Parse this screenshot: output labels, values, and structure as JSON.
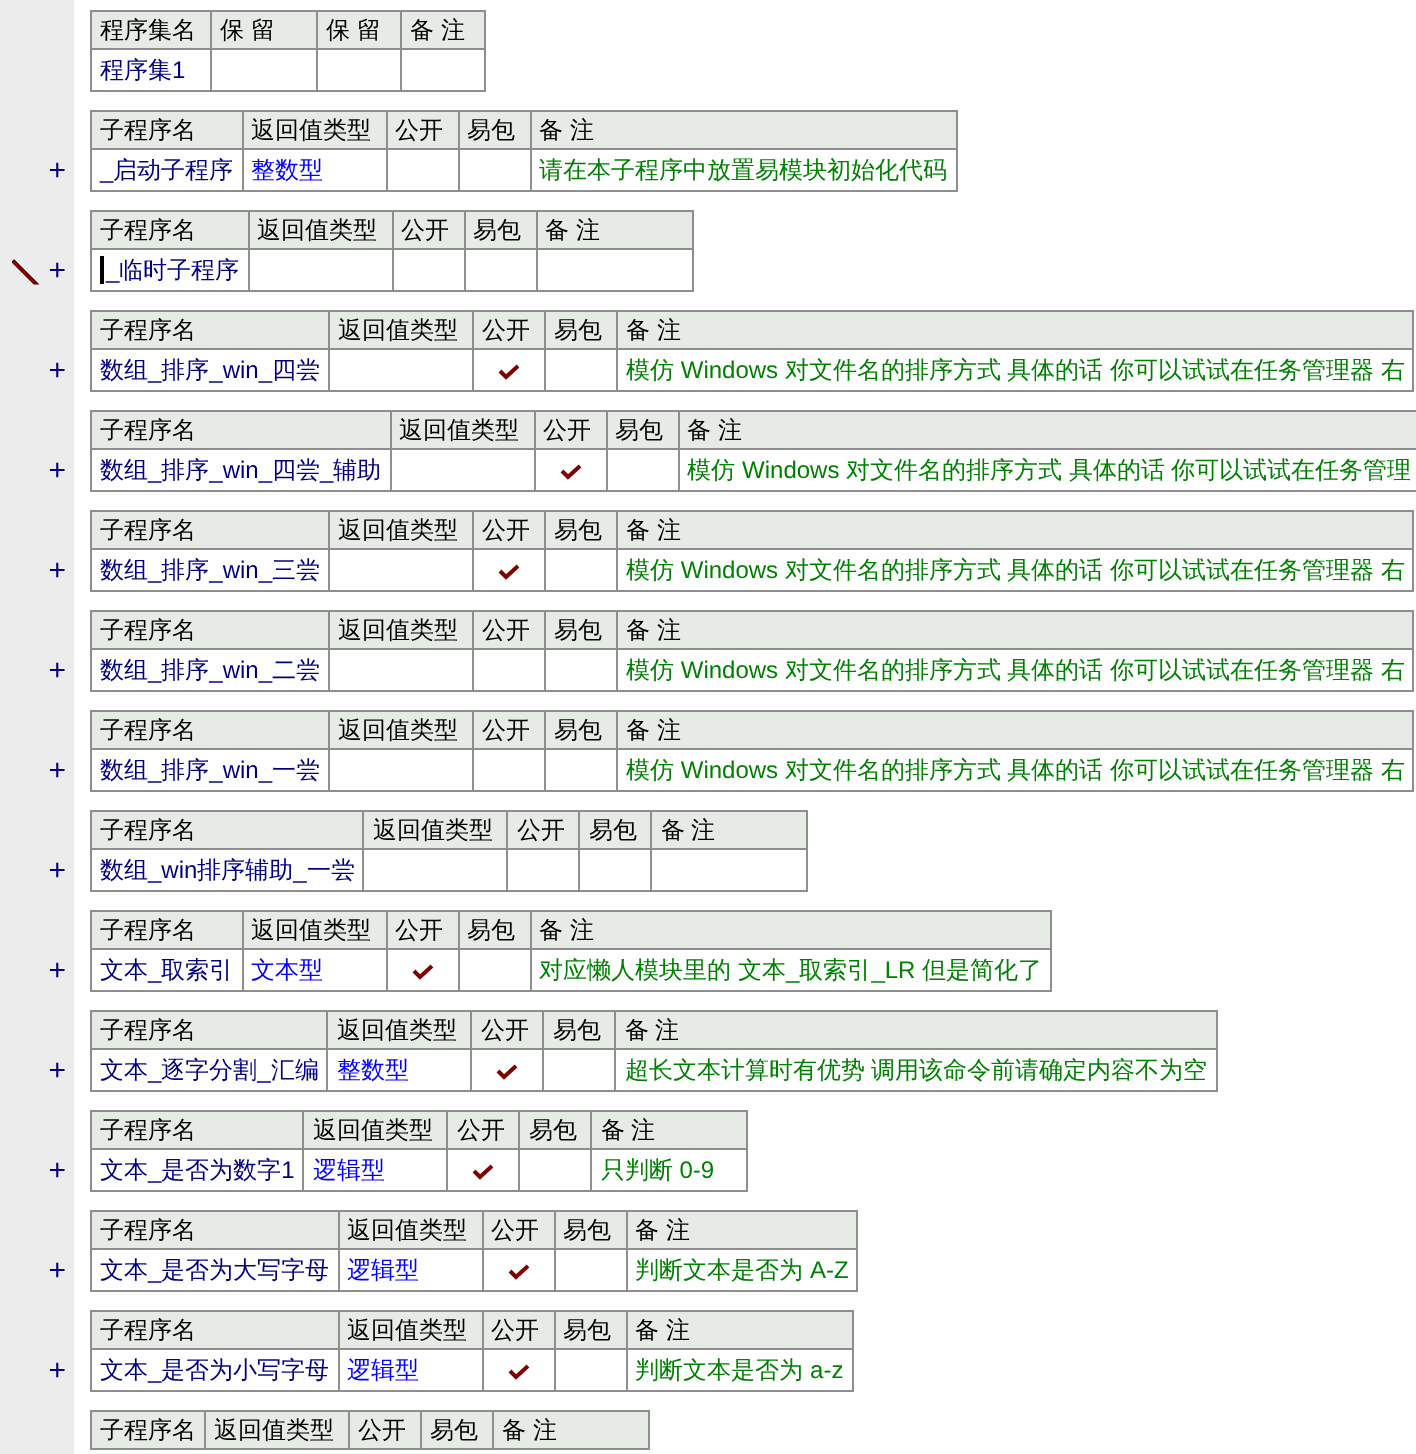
{
  "assembly": {
    "columns": [
      "程序集名",
      "保 留",
      "保 留",
      "备 注"
    ],
    "name": "程序集1"
  },
  "subprograms": [
    {
      "expander": "+",
      "editing": false,
      "columns": [
        "子程序名",
        "返回值类型",
        "公开",
        "易包",
        "备 注"
      ],
      "name": "_启动子程序",
      "return_type": "整数型",
      "public": false,
      "remark": "请在本子程序中放置易模块初始化代码"
    },
    {
      "expander": "+",
      "editing": true,
      "columns": [
        "子程序名",
        "返回值类型",
        "公开",
        "易包",
        "备 注"
      ],
      "name": "_临时子程序",
      "public": false
    },
    {
      "expander": "+",
      "editing": false,
      "columns": [
        "子程序名",
        "返回值类型",
        "公开",
        "易包",
        "备 注"
      ],
      "name": "数组_排序_win_四尝",
      "public": true,
      "remark": "模仿 Windows 对文件名的排序方式 具体的话 你可以试试在任务管理器 右"
    },
    {
      "expander": "+",
      "editing": false,
      "columns": [
        "子程序名",
        "返回值类型",
        "公开",
        "易包",
        "备 注"
      ],
      "name": "数组_排序_win_四尝_辅助",
      "public": true,
      "remark": "模仿 Windows 对文件名的排序方式 具体的话 你可以试试在任务管理"
    },
    {
      "expander": "+",
      "editing": false,
      "columns": [
        "子程序名",
        "返回值类型",
        "公开",
        "易包",
        "备 注"
      ],
      "name": "数组_排序_win_三尝",
      "public": true,
      "remark": "模仿 Windows 对文件名的排序方式 具体的话 你可以试试在任务管理器 右"
    },
    {
      "expander": "+",
      "editing": false,
      "columns": [
        "子程序名",
        "返回值类型",
        "公开",
        "易包",
        "备 注"
      ],
      "name": "数组_排序_win_二尝",
      "public": false,
      "remark": "模仿 Windows 对文件名的排序方式 具体的话 你可以试试在任务管理器 右"
    },
    {
      "expander": "+",
      "editing": false,
      "columns": [
        "子程序名",
        "返回值类型",
        "公开",
        "易包",
        "备 注"
      ],
      "name": "数组_排序_win_一尝",
      "public": false,
      "remark": "模仿 Windows 对文件名的排序方式 具体的话 你可以试试在任务管理器 右"
    },
    {
      "expander": "+",
      "editing": false,
      "columns": [
        "子程序名",
        "返回值类型",
        "公开",
        "易包",
        "备 注"
      ],
      "name": "数组_win排序辅助_一尝",
      "public": false
    },
    {
      "expander": "+",
      "editing": false,
      "columns": [
        "子程序名",
        "返回值类型",
        "公开",
        "易包",
        "备 注"
      ],
      "name": "文本_取索引",
      "return_type": "文本型",
      "public": true,
      "remark": "对应懒人模块里的 文本_取索引_LR 但是简化了"
    },
    {
      "expander": "+",
      "editing": false,
      "columns": [
        "子程序名",
        "返回值类型",
        "公开",
        "易包",
        "备 注"
      ],
      "name": "文本_逐字分割_汇编",
      "return_type": "整数型",
      "public": true,
      "remark": "超长文本计算时有优势 调用该命令前请确定内容不为空"
    },
    {
      "expander": "+",
      "editing": false,
      "columns": [
        "子程序名",
        "返回值类型",
        "公开",
        "易包",
        "备 注"
      ],
      "name": "文本_是否为数字1",
      "return_type": "逻辑型",
      "public": true,
      "remark": "只判断 0-9"
    },
    {
      "expander": "+",
      "editing": false,
      "columns": [
        "子程序名",
        "返回值类型",
        "公开",
        "易包",
        "备 注"
      ],
      "name": "文本_是否为大写字母",
      "return_type": "逻辑型",
      "public": true,
      "remark": "判断文本是否为 A-Z"
    },
    {
      "expander": "+",
      "editing": false,
      "columns": [
        "子程序名",
        "返回值类型",
        "公开",
        "易包",
        "备 注"
      ],
      "name": "文本_是否为小写字母",
      "return_type": "逻辑型",
      "public": true,
      "remark": "判断文本是否为 a-z"
    },
    {
      "columns": [
        "子程序名",
        "返回值类型",
        "公开",
        "易包",
        "备 注"
      ]
    }
  ]
}
